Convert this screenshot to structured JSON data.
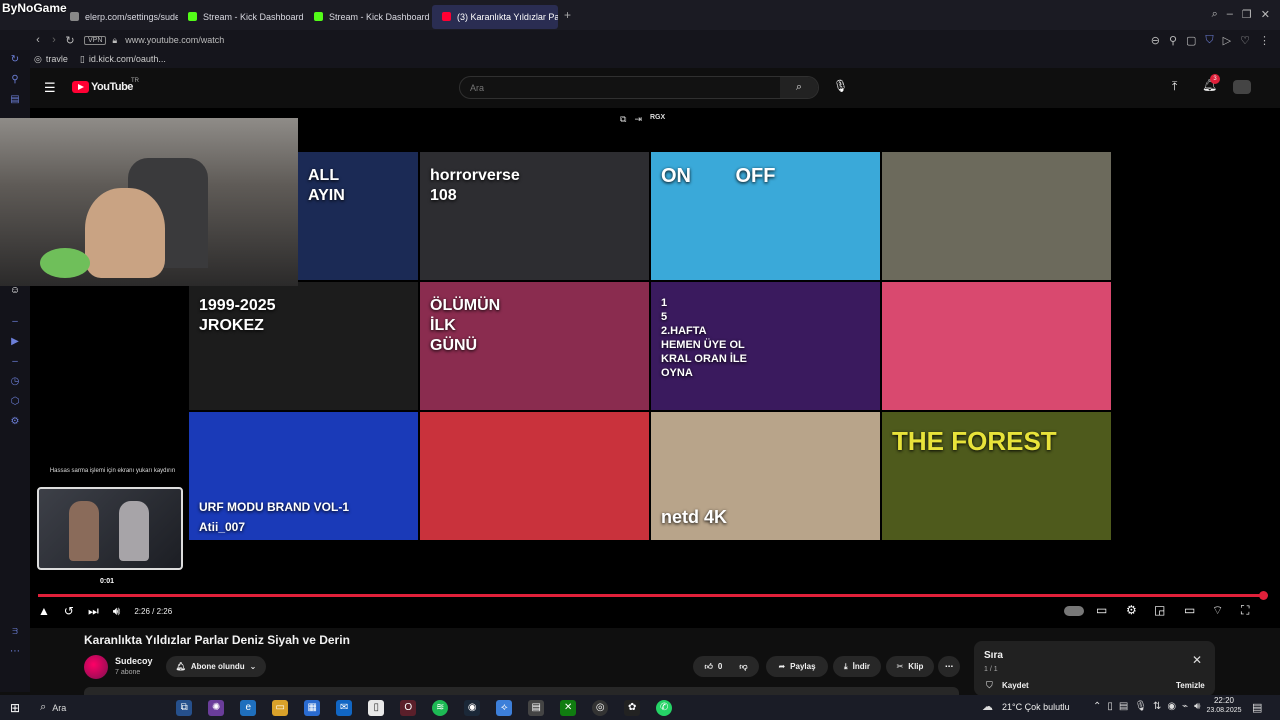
{
  "watermark": "ByNoGame",
  "tabs": [
    {
      "label": "elerp.com/settings/sudec",
      "color": "#888888",
      "active": false
    },
    {
      "label": "Stream - Kick Dashboard",
      "color": "#53fc18",
      "active": false
    },
    {
      "label": "Stream - Kick Dashboard",
      "color": "#53fc18",
      "active": false
    },
    {
      "label": "(3) Karanlıkta Yıldızlar Par",
      "color": "#ff0033",
      "active": true
    }
  ],
  "address": {
    "vpn": "VPN",
    "url": "www.youtube.com/watch"
  },
  "bookmarks": [
    {
      "label": "travle"
    },
    {
      "label": "id.kick.com/oauth..."
    }
  ],
  "youtube": {
    "logo": "YouTube",
    "region": "TR",
    "search_placeholder": "Ara",
    "notification_count": "3"
  },
  "overlay_tools": [
    "RGX"
  ],
  "thumbnails": [
    {
      "text": "ALL\nAYIN",
      "bg": "#1b2a55"
    },
    {
      "text": "horrorverse\n108",
      "bg": "#2d2d31"
    },
    {
      "text": "ON        OFF",
      "bg": "#3aa9d9"
    },
    {
      "text": "",
      "bg": "#6c6a5c"
    },
    {
      "text": "1999-2025\nJROKEZ",
      "bg": "#1c1c1c"
    },
    {
      "text": "ÖLÜMÜN\nİLK\nGÜNÜ",
      "bg": "#8a2c4f"
    },
    {
      "text": "1\n5\n2.HAFTA\nHEMEN ÜYE OL\nKRAL ORAN İLE\nOYNA",
      "bg": "#3a1a5e"
    },
    {
      "text": "",
      "bg": "#d9496f"
    },
    {
      "text": "URF MODU BRAND VOL-1\nAtii_007",
      "bg": "#1a3ab8"
    },
    {
      "text": "",
      "bg": "#c9323c"
    },
    {
      "text": "netd 4K",
      "bg": "#b8a48a"
    },
    {
      "text": "THE FOREST",
      "bg": "#4e5a1c"
    }
  ],
  "pip": {
    "hint": "Hassas sarma işlemi için ekranı yukarı kaydırın",
    "time": "0:01"
  },
  "player": {
    "time": "2:26 / 2:26",
    "progress": 1.0
  },
  "video": {
    "title": "Karanlıkta Yıldızlar Parlar Deniz Siyah ve Derin",
    "channel": "Sudecoy",
    "subs": "7 abone",
    "subscribe": "Abone olundu",
    "likes": "0",
    "share": "Paylaş",
    "download": "İndir",
    "clip": "Klip"
  },
  "queue": {
    "title": "Sıra",
    "count": "1 / 1",
    "save": "Kaydet",
    "clear": "Temizle"
  },
  "taskbar": {
    "search": "Ara",
    "weather": "21°C  Çok bulutlu",
    "time": "22:20",
    "date": "23.08.2025"
  },
  "colors": {
    "accent": "#e0203a",
    "chrome": "#1b1b23",
    "kick": "#53fc18"
  }
}
